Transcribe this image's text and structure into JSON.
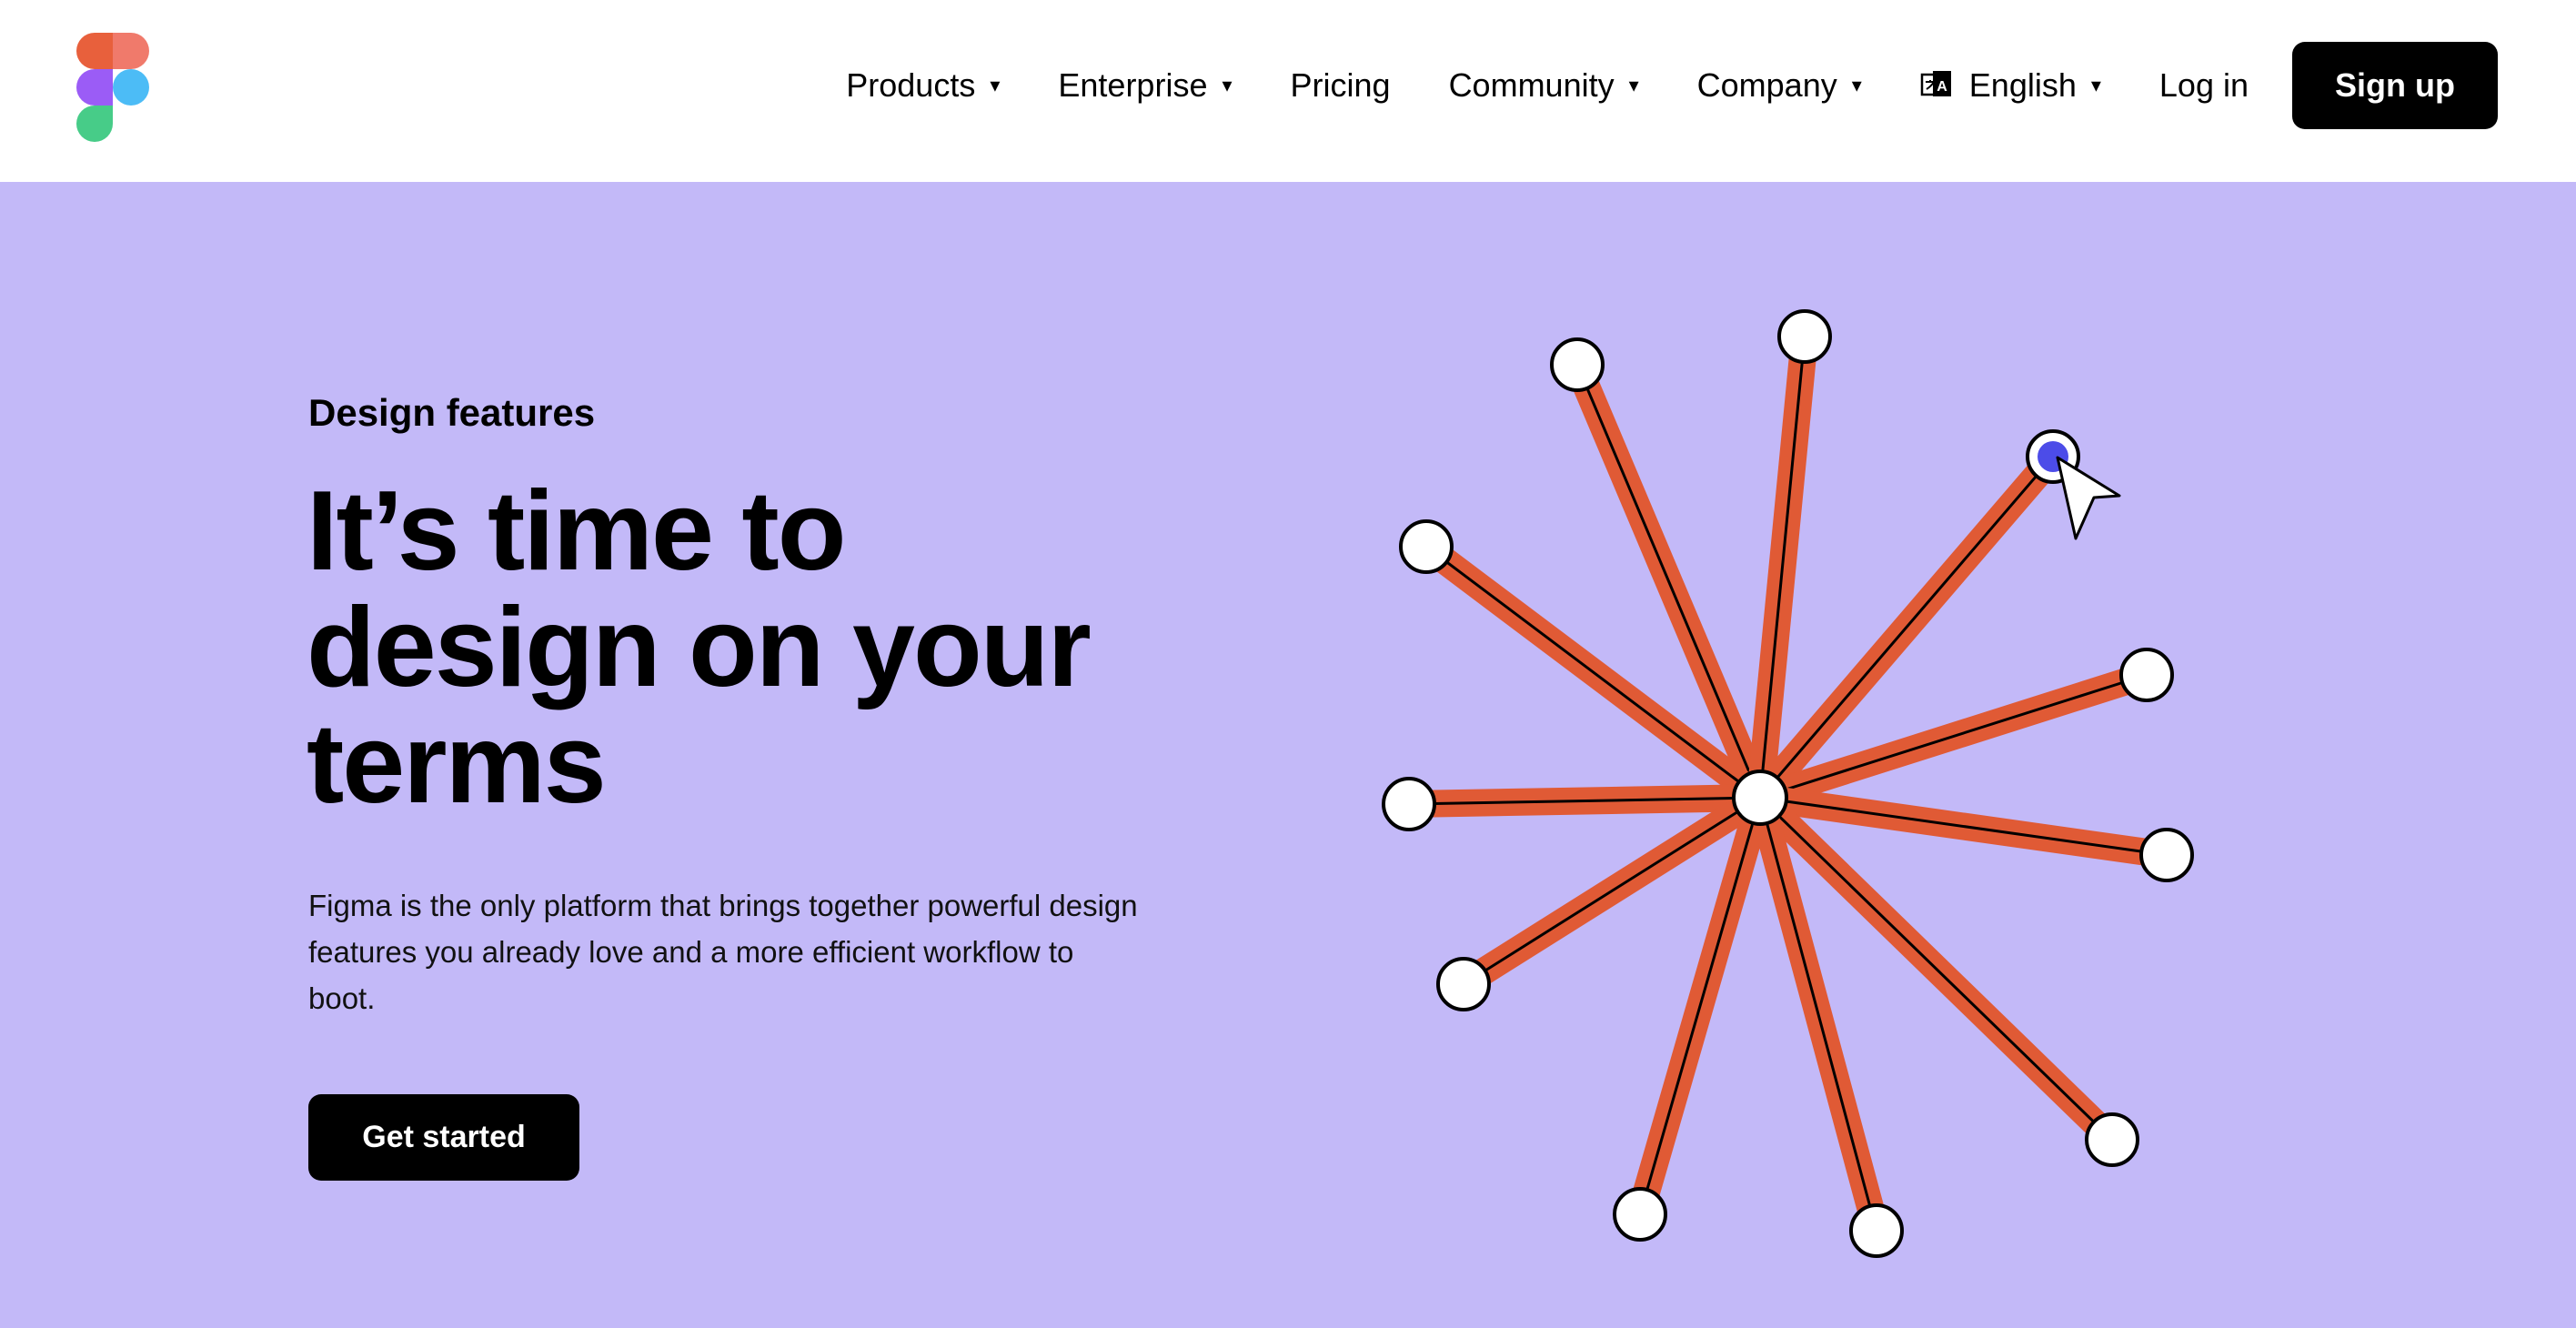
{
  "header": {
    "nav": {
      "products": "Products",
      "enterprise": "Enterprise",
      "pricing": "Pricing",
      "community": "Community",
      "company": "Company",
      "language": "English",
      "login": "Log in",
      "signup": "Sign up"
    },
    "caret": "▾"
  },
  "hero": {
    "eyebrow": "Design features",
    "headline": "It’s time to design on your terms",
    "body": "Figma is the only platform that brings together powerful design features you already love and a more efficient workflow to boot.",
    "cta": "Get started"
  },
  "colors": {
    "hero_background": "#c3b9f8",
    "spoke_orange": "#e05a35",
    "selected_node": "#4c4ce8",
    "logo_red": "#f24e1e",
    "logo_salmon": "#ff7262",
    "logo_purple": "#a259ff",
    "logo_blue": "#1abcfe",
    "logo_green": "#0acf83"
  },
  "icons": [
    "figma-logo",
    "language-icon",
    "chevron-down-icon",
    "cursor-arrow-icon"
  ]
}
